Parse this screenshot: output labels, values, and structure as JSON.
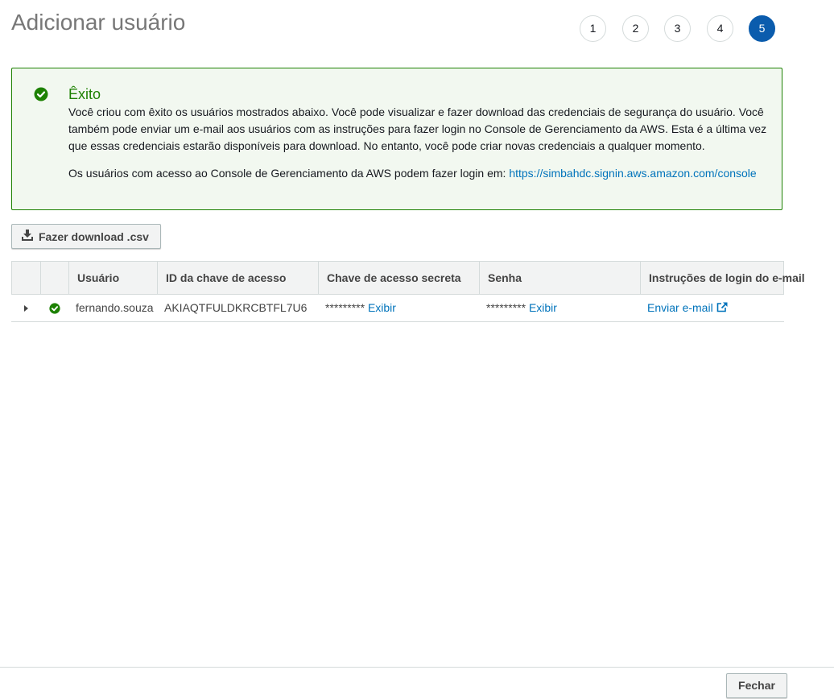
{
  "page": {
    "title": "Adicionar usuário"
  },
  "steps": [
    {
      "label": "1",
      "active": false
    },
    {
      "label": "2",
      "active": false
    },
    {
      "label": "3",
      "active": false
    },
    {
      "label": "4",
      "active": false
    },
    {
      "label": "5",
      "active": true
    }
  ],
  "alert": {
    "icon": "check-circle-icon",
    "title": "Êxito",
    "text": "Você criou com êxito os usuários mostrados abaixo. Você pode visualizar e fazer download das credenciais de segurança do usuário. Você também pode enviar um e-mail aos usuários com as instruções para fazer login no Console de Gerenciamento da AWS. Esta é a última vez que essas credenciais estarão disponíveis para download. No entanto, você pode criar novas credenciais a qualquer momento.",
    "login_prefix": "Os usuários com acesso ao Console de Gerenciamento da AWS podem fazer login em:",
    "login_url": "https://simbahdc.signin.aws.amazon.com/console"
  },
  "toolbar": {
    "download_label": "Fazer download .csv",
    "download_icon": "download-icon"
  },
  "table": {
    "headers": {
      "user": "Usuário",
      "access_key_id": "ID da chave de acesso",
      "secret_key": "Chave de acesso secreta",
      "password": "Senha",
      "email_instructions": "Instruções de login do e-mail"
    },
    "rows": [
      {
        "user": "fernando.souza",
        "access_key_id": "AKIAQTFULDKRCBTFL7U6",
        "secret_masked": "*********",
        "secret_action": "Exibir",
        "password_masked": "*********",
        "password_action": "Exibir",
        "email_action": "Enviar e-mail"
      }
    ]
  },
  "footer": {
    "close_label": "Fechar"
  },
  "colors": {
    "success": "#1d8102",
    "link": "#0073bb",
    "active_step": "#0b5cad"
  }
}
